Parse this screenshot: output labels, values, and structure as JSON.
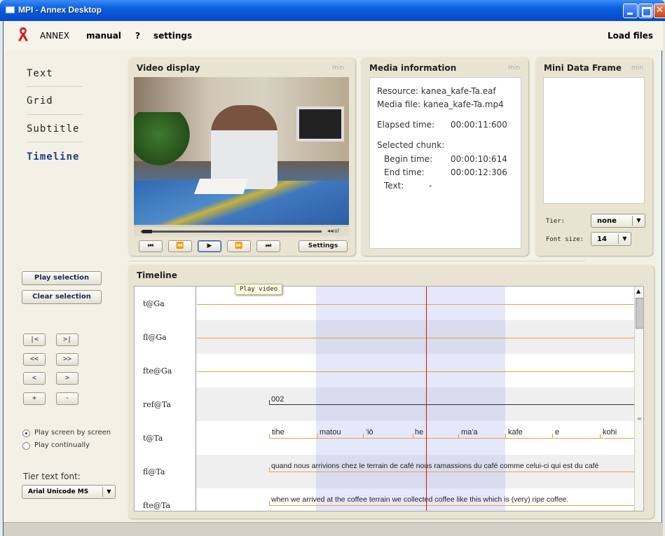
{
  "window": {
    "title": "MPI - Annex Desktop"
  },
  "menu": {
    "app_name": "ANNEX",
    "manual": "manual",
    "help": "?",
    "settings": "settings",
    "load_files": "Load files"
  },
  "nav": [
    {
      "label": "Text"
    },
    {
      "label": "Grid"
    },
    {
      "label": "Subtitle"
    },
    {
      "label": "Timeline"
    }
  ],
  "video_panel": {
    "title": "Video display",
    "min": "min",
    "controls": {
      "first": "⏮",
      "back": "⏪",
      "play": "▶",
      "forward": "⏩",
      "last": "⏭",
      "settings": "Settings"
    },
    "volume_icon": "◂◂ıııl"
  },
  "media_panel": {
    "title": "Media information",
    "min": "min",
    "resource": "Resource: kanea_kafe-Ta.eaf",
    "media_file": "Media file: kanea_kafe-Ta.mp4",
    "elapsed_label": "Elapsed time:",
    "elapsed_value": "00:00:11:600",
    "selected_chunk": "Selected chunk:",
    "begin_label": "Begin time:",
    "begin_value": "00:00:10:614",
    "end_label": "End time:",
    "end_value": "00:00:12:306",
    "text_label": "Text:",
    "text_value": "-"
  },
  "mini_panel": {
    "title": "Mini Data Frame",
    "min": "min",
    "tier_label": "Tier:",
    "tier_value": "none",
    "font_size_label": "Font size:",
    "font_size_value": "14"
  },
  "left_controls": {
    "play_selection": "Play selection",
    "clear_selection": "Clear selection",
    "nav_buttons": [
      "|<",
      ">|",
      "<<",
      ">>",
      "<",
      ">",
      "+",
      "-"
    ],
    "radio_screen": "Play screen by screen",
    "radio_continual": "Play continually",
    "tier_font_label": "Tier text font:",
    "tier_font_value": "Arial Unicode MS"
  },
  "tooltip": "Play video",
  "timeline_panel": {
    "title": "Timeline",
    "tiers": [
      {
        "name": "t@Ga"
      },
      {
        "name": "fl@Ga"
      },
      {
        "name": "fte@Ga"
      },
      {
        "name": "ref@Ta"
      },
      {
        "name": "t@Ta"
      },
      {
        "name": "fl@Ta"
      },
      {
        "name": "fte@Ta"
      }
    ],
    "ref_annotation": "002",
    "t_words": [
      "tihe",
      "matou",
      "'iō",
      "he",
      "ma'a",
      "kafe",
      "e",
      "kohi"
    ],
    "fl_text": "quand nous arrivions chez le terrain de café nous ramassions du café comme celui-ci qui est du café",
    "fte_text": "when we arrived at the coffee terrain we collected coffee like this which is (very) ripe coffee."
  },
  "colors": {
    "tier_line": "#e8a23a",
    "cursor": "#dd1111",
    "selection": "#b5bbf0",
    "logo": "#d51e1e"
  }
}
